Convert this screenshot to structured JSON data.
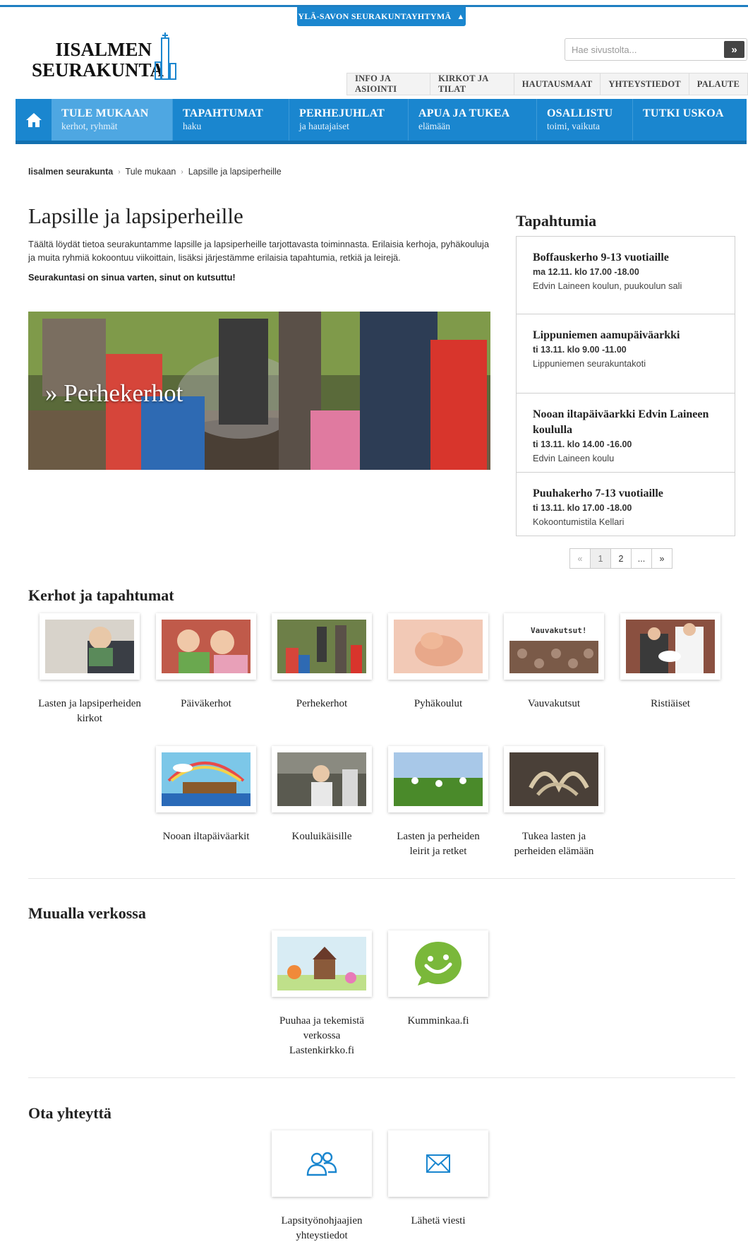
{
  "header": {
    "regional_link": "YLÄ-SAVON SEURAKUNTAYHTYMÄ",
    "logo_line1": "IISALMEN",
    "logo_line2": "SEURAKUNTA",
    "search_placeholder": "Hae sivustolta...",
    "search_button": "»"
  },
  "utility_nav": [
    "INFO JA ASIOINTI",
    "KIRKOT JA TILAT",
    "HAUTAUSMAAT",
    "YHTEYSTIEDOT",
    "PALAUTE"
  ],
  "main_nav": [
    {
      "title": "TULE MUKAAN",
      "sub": "kerhot, ryhmät"
    },
    {
      "title": "TAPAHTUMAT",
      "sub": "haku"
    },
    {
      "title": "PERHEJUHLAT",
      "sub": "ja hautajaiset"
    },
    {
      "title": "APUA JA TUKEA",
      "sub": "elämään"
    },
    {
      "title": "OSALLISTU",
      "sub": "toimi, vaikuta"
    },
    {
      "title": "TUTKI USKOA",
      "sub": ""
    }
  ],
  "breadcrumb": [
    "Iisalmen seurakunta",
    "Tule mukaan",
    "Lapsille ja lapsiperheille"
  ],
  "page": {
    "title": "Lapsille ja lapsiperheille",
    "intro": "Täältä löydät tietoa seurakuntamme lapsille ja lapsiperheille tarjottavasta toiminnasta. Erilaisia kerhoja, pyhäkouluja ja muita ryhmiä kokoontuu viikoittain, lisäksi järjestämme erilaisia tapahtumia, retkiä ja leirejä.",
    "intro_strong": "Seurakuntasi on sinua varten, sinut on kutsuttu!",
    "hero_caption": "» Perhekerhot"
  },
  "events": {
    "title": "Tapahtumia",
    "items": [
      {
        "title": "Boffauskerho 9-13 vuotiaille",
        "date": "ma 12.11. klo 17.00 -18.00",
        "place": "Edvin Laineen koulun, puukoulun sali"
      },
      {
        "title": "Lippuniemen aamupäiväarkki",
        "date": "ti 13.11. klo 9.00 -11.00",
        "place": "Lippuniemen seurakuntakoti"
      },
      {
        "title": "Nooan iltapäiväarkki Edvin Laineen koululla",
        "date": "ti 13.11. klo 14.00 -16.00",
        "place": "Edvin Laineen koulu"
      },
      {
        "title": "Puuhakerho 7-13 vuotiaille",
        "date": "ti 13.11. klo 17.00 -18.00",
        "place": "Kokoontumistila Kellari"
      }
    ],
    "pager": [
      "«",
      "1",
      "2",
      "...",
      "»"
    ]
  },
  "sections": {
    "clubs_title": "Kerhot ja tapahtumat",
    "clubs": [
      "Lasten ja lapsiperheiden kirkot",
      "Päiväkerhot",
      "Perhekerhot",
      "Pyhäkoulut",
      "Vauvakutsut",
      "Ristiäiset",
      "Nooan iltapäiväarkit",
      "Kouluikäisille",
      "Lasten ja perheiden leirit ja retket",
      "Tukea lasten ja perheiden elämään"
    ],
    "vauva_banner": "Vauvakutsut!",
    "web_title": "Muualla verkossa",
    "web": [
      "Puuhaa ja tekemistä verkossa Lastenkirkko.fi",
      "Kumminkaa.fi"
    ],
    "contact_title": "Ota yhteyttä",
    "contact": [
      "Lapsityönohjaajien yhteystiedot",
      "Lähetä viesti"
    ]
  },
  "colors": {
    "brand_blue": "#1a86cf",
    "nav_active": "#4ea7e2"
  }
}
